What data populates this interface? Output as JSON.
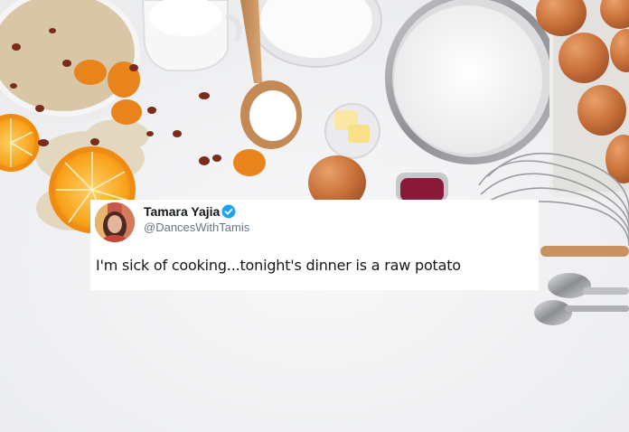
{
  "tweet": {
    "display_name": "Tamara Yajia",
    "handle": "@DancesWithTamis",
    "text": "I'm sick of cooking...tonight's dinner is a raw potato",
    "verified": true,
    "verified_icon": "verified-badge-icon",
    "accent_color": "#1da1f2"
  }
}
